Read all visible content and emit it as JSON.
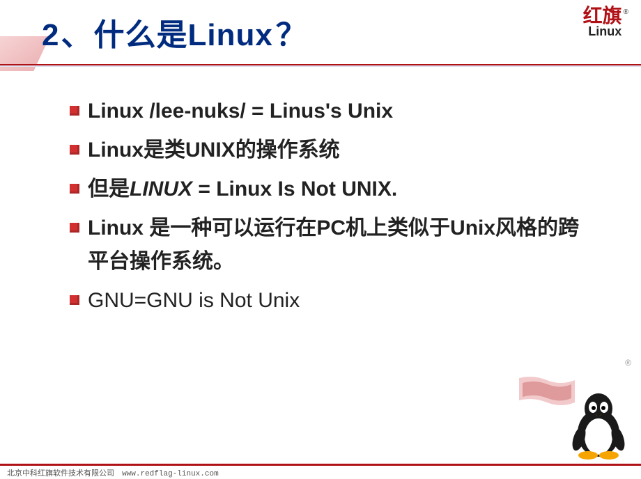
{
  "header": {
    "number": "2",
    "separator": "、",
    "title_cn": "什么是",
    "title_en": "Linux",
    "title_q": "？"
  },
  "logo": {
    "hanzi": "红旗",
    "reg": "®",
    "latin": "Linux"
  },
  "bullets": {
    "b1": "Linux /lee-nuks/ = Linus's Unix",
    "b2_a": "Linux",
    "b2_b": "是类",
    "b2_c": "UNIX",
    "b2_d": "的操作系统",
    "b3_a": "但是",
    "b3_b": "LINUX",
    "b3_c": " = Linux Is Not UNIX.",
    "b4_a": "Linux ",
    "b4_b": "是一种可以运行在",
    "b4_c": "PC",
    "b4_d": "机上类似于",
    "b4_e": "Unix",
    "b4_f": "风格的跨平台操作系统。",
    "b5": "GNU=GNU is Not Unix"
  },
  "footer": {
    "company": "北京中科红旗软件技术有限公司",
    "url": "www.redflag-linux.com"
  },
  "deco": {
    "r_small": "®"
  }
}
